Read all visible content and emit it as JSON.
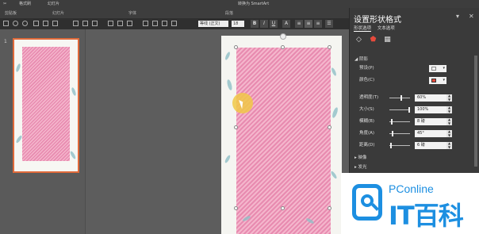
{
  "ribbon": {
    "top_items": [
      "格式刷",
      "幻灯片",
      "转换为 SmartArt"
    ],
    "group_labels": [
      "剪贴板",
      "幻灯片",
      "字体",
      "段落"
    ],
    "font_name": "等线 (正文)",
    "font_size": "18"
  },
  "slide_panel": {
    "slide_number": "1"
  },
  "format_panel": {
    "title": "设置形状格式",
    "tabs": [
      "形状选项",
      "文本选项"
    ],
    "section_shadow": "阴影",
    "rows": [
      {
        "label": "预设(P)"
      },
      {
        "label": "颜色(C)"
      },
      {
        "label": "透明度(T)",
        "value": "60%",
        "level": 0.6
      },
      {
        "label": "大小(S)",
        "value": "100%",
        "level": 1.0
      },
      {
        "label": "模糊(B)",
        "value": "8 磅",
        "level": 0.1
      },
      {
        "label": "角度(A)",
        "value": "45°",
        "level": 0.12
      },
      {
        "label": "距离(D)",
        "value": "6 磅",
        "level": 0.06
      }
    ],
    "section_reflection": "映像",
    "section_glow": "发光"
  },
  "watermark": {
    "brand": "PConline",
    "name": "IT百科"
  },
  "colors": {
    "pink": "#e88bb0",
    "accent": "#e06a3a",
    "brand_blue": "#1d8fe1"
  }
}
